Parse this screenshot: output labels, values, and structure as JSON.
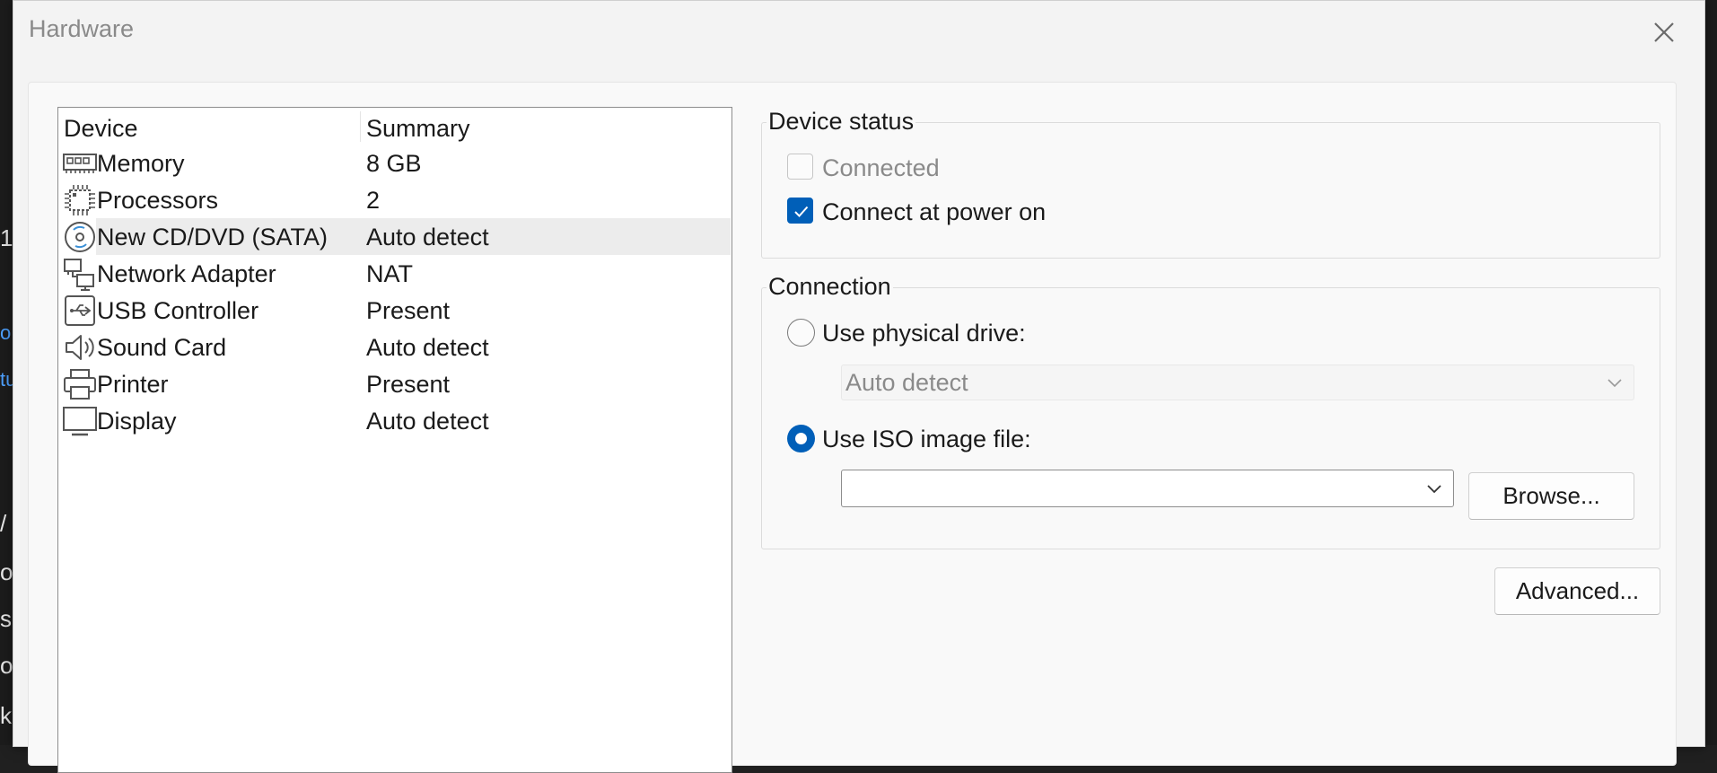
{
  "background_fragments": [
    "1",
    "o",
    "tu",
    "/",
    "o",
    "sk",
    "o",
    "k"
  ],
  "dialog": {
    "title": "Hardware",
    "close_icon": "close-icon"
  },
  "device_list": {
    "headers": {
      "device": "Device",
      "summary": "Summary"
    },
    "rows": [
      {
        "icon": "memory-icon",
        "device": "Memory",
        "summary": "8 GB"
      },
      {
        "icon": "processor-icon",
        "device": "Processors",
        "summary": "2"
      },
      {
        "icon": "cd-dvd-icon",
        "device": "New CD/DVD (SATA)",
        "summary": "Auto detect",
        "selected": true
      },
      {
        "icon": "network-adapter-icon",
        "device": "Network Adapter",
        "summary": "NAT"
      },
      {
        "icon": "usb-icon",
        "device": "USB Controller",
        "summary": "Present"
      },
      {
        "icon": "sound-card-icon",
        "device": "Sound Card",
        "summary": "Auto detect"
      },
      {
        "icon": "printer-icon",
        "device": "Printer",
        "summary": "Present"
      },
      {
        "icon": "display-icon",
        "device": "Display",
        "summary": "Auto detect"
      }
    ]
  },
  "device_status": {
    "label": "Device status",
    "connected": {
      "label": "Connected",
      "checked": false,
      "enabled": false
    },
    "connect_at_power_on": {
      "label": "Connect at power on",
      "checked": true
    }
  },
  "connection": {
    "label": "Connection",
    "use_physical_drive": {
      "label": "Use physical drive:",
      "selected": false
    },
    "physical_drive_select": {
      "value": "Auto detect",
      "enabled": false
    },
    "use_iso_image": {
      "label": "Use ISO image file:",
      "selected": true
    },
    "iso_path": {
      "value": ""
    },
    "browse_label": "Browse..."
  },
  "advanced_label": "Advanced...",
  "colors": {
    "accent": "#005fb8",
    "selected_row": "#ececec",
    "dialog_bg": "#f3f3f3"
  }
}
